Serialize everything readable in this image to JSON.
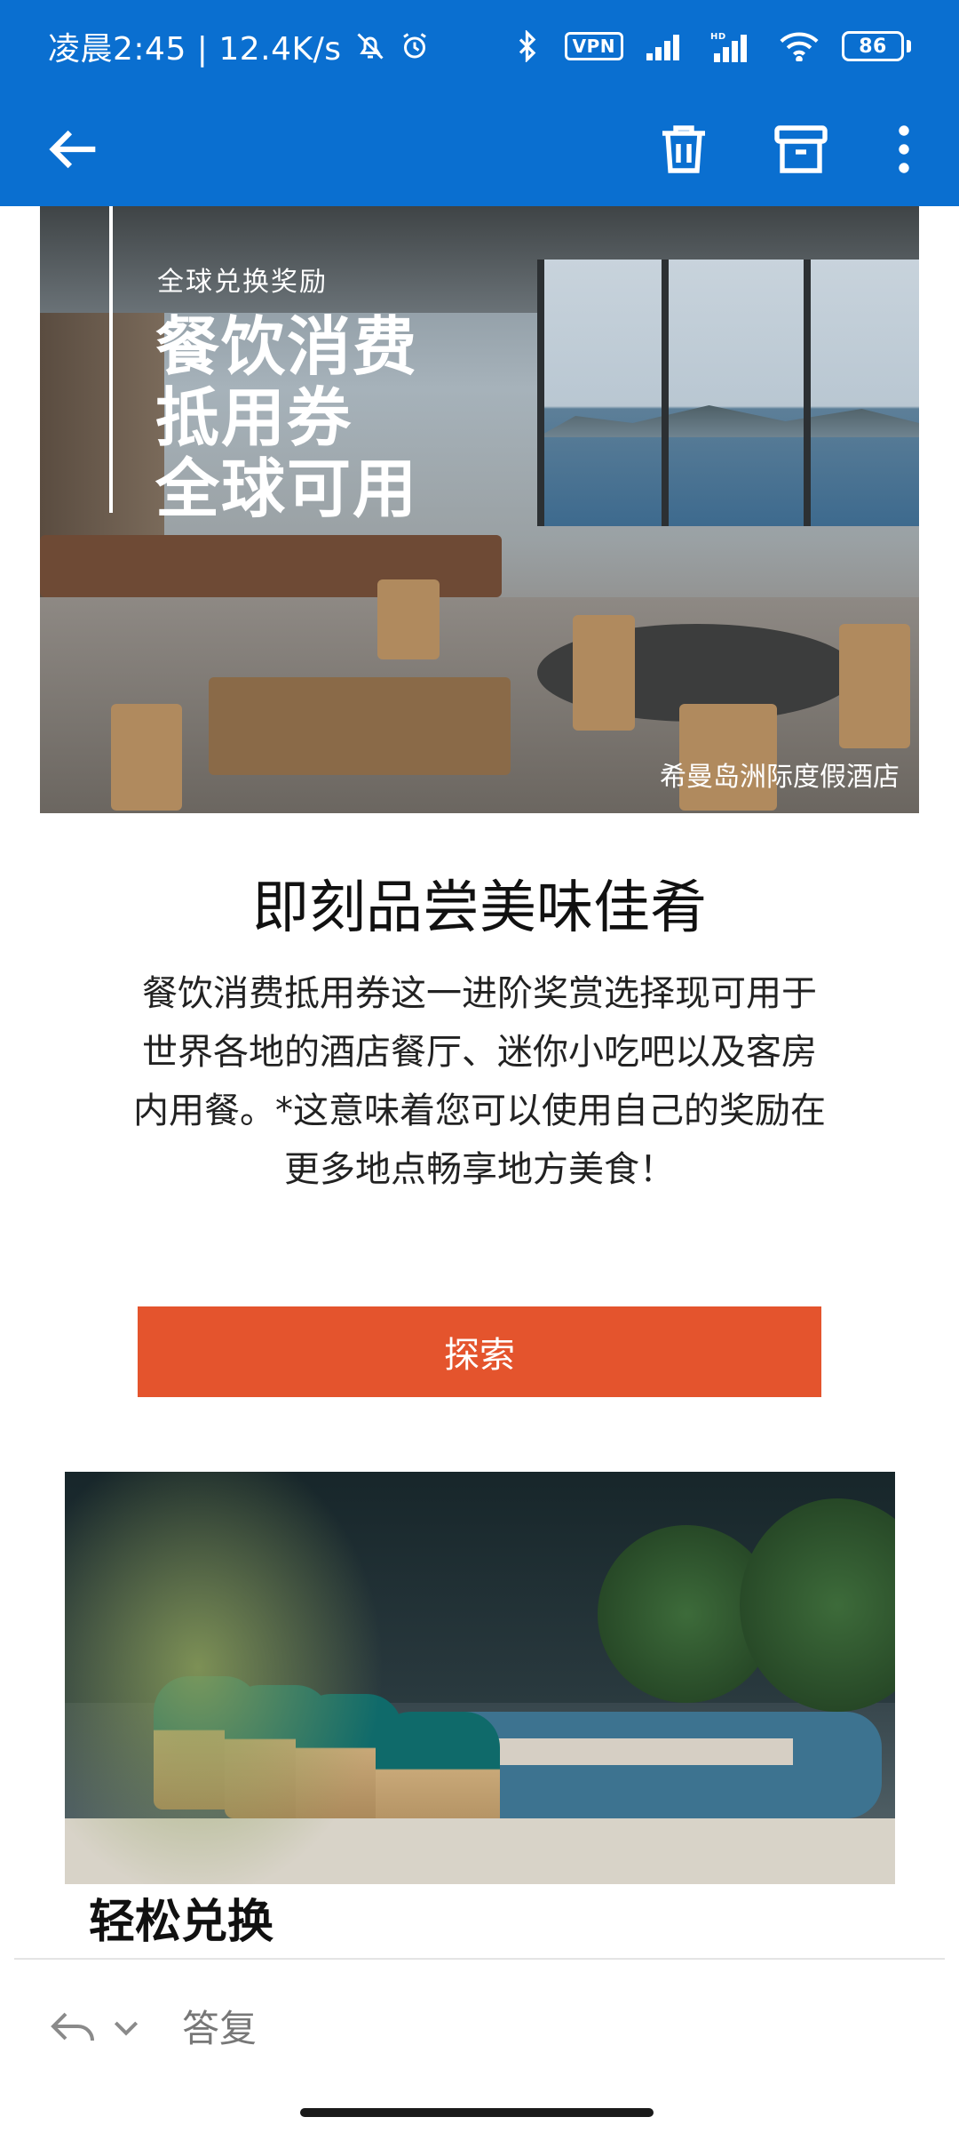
{
  "status_bar": {
    "time_speed": "凌晨2:45 | 12.4K/s",
    "vpn": "VPN",
    "battery": "86"
  },
  "toolbar": {
    "back": "back",
    "delete": "delete",
    "archive": "archive",
    "more": "more"
  },
  "hero": {
    "eyebrow": "全球兑换奖励",
    "headline_line1": "餐饮消费",
    "headline_line2": "抵用券",
    "headline_line3": "全球可用",
    "caption": "希曼岛洲际度假酒店"
  },
  "content": {
    "title": "即刻品尝美味佳肴",
    "paragraph": "餐饮消费抵用券这一进阶奖赏选择现可用于世界各地的酒店餐厅、迷你小吃吧以及客房内用餐。*这意味着您可以使用自己的奖励在更多地点畅享地方美食！",
    "explore_button": "探索",
    "subheading": "轻松兑换"
  },
  "reply_bar": {
    "reply_label": "答复"
  },
  "colors": {
    "header_blue": "#0a6fd0",
    "cta_orange": "#e4542d"
  }
}
